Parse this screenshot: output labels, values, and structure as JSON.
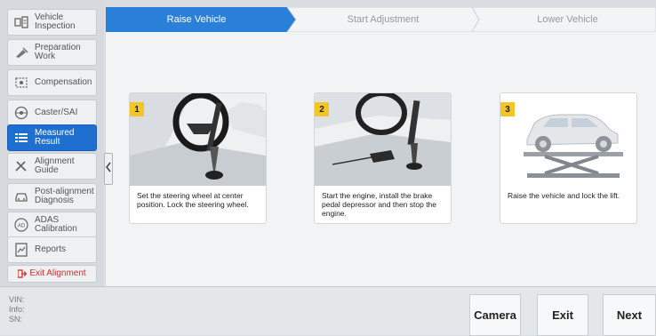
{
  "sidebar": {
    "items": [
      {
        "label": "Vehicle Inspection",
        "line1": "Vehicle",
        "line2": "Inspection",
        "icon": "vehicle-inspection-icon"
      },
      {
        "label": "Preparation Work",
        "line1": "Preparation",
        "line2": "Work",
        "icon": "preparation-icon"
      },
      {
        "label": "Compensation",
        "line1": "Compensation",
        "line2": "",
        "icon": "compensation-icon"
      },
      {
        "label": "Caster/SAI",
        "line1": "Caster/SAI",
        "line2": "",
        "icon": "caster-icon"
      },
      {
        "label": "Measured Result",
        "line1": "Measured",
        "line2": "Result",
        "icon": "measured-result-icon",
        "active": true
      },
      {
        "label": "Alignment Guide",
        "line1": "Alignment",
        "line2": "Guide",
        "icon": "alignment-guide-icon"
      },
      {
        "label": "Post-alignment Diagnosis",
        "line1": "Post-alignment",
        "line2": "Diagnosis",
        "icon": "car-icon"
      },
      {
        "label": "ADAS Calibration",
        "line1": "ADAS",
        "line2": "Calibration",
        "icon": "adas-icon"
      },
      {
        "label": "Reports",
        "line1": "Reports",
        "line2": "",
        "icon": "report-icon"
      }
    ],
    "exit_label": "Exit Alignment"
  },
  "steps": [
    {
      "label": "Raise Vehicle",
      "active": true
    },
    {
      "label": "Start Adjustment",
      "active": false
    },
    {
      "label": "Lower Vehicle",
      "active": false
    }
  ],
  "cards": [
    {
      "number": "1",
      "caption": "Set the steering wheel at center position. Lock the steering wheel."
    },
    {
      "number": "2",
      "caption": "Start the engine, install the brake pedal depressor and then stop the engine."
    },
    {
      "number": "3",
      "caption": "Raise the vehicle and lock the lift."
    }
  ],
  "info": {
    "vin_label": "VIN:",
    "info_label": "Info:",
    "sn_label": "SN:"
  },
  "buttons": {
    "camera": "Camera",
    "exit": "Exit",
    "next": "Next"
  },
  "colors": {
    "accent": "#1f6fd1",
    "step_active": "#2a7fd9",
    "badge": "#f3c623",
    "exit_text": "#d32f2f"
  }
}
